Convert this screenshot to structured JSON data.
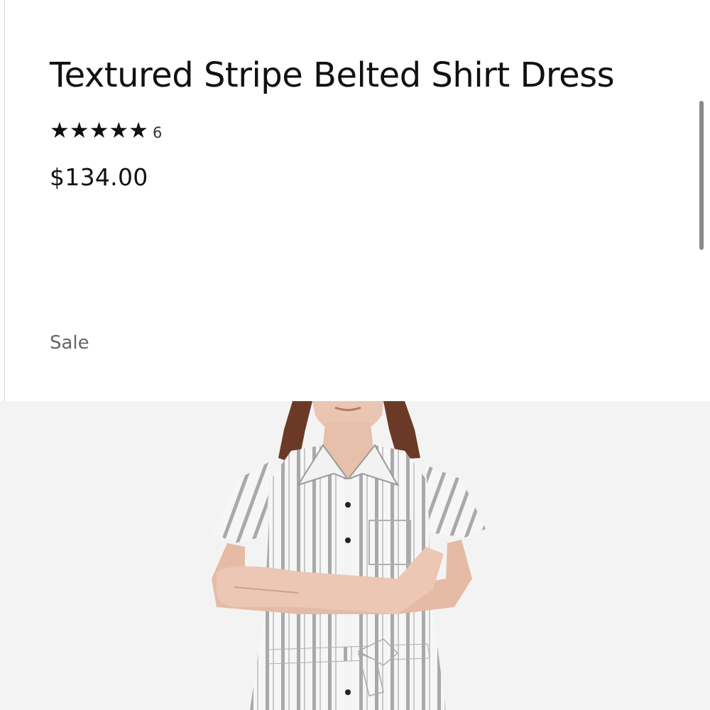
{
  "product": {
    "title": "Textured Stripe Belted Shirt Dress",
    "rating": {
      "stars_text": "★★★★★",
      "value": 5,
      "max": 5,
      "review_count": "6"
    },
    "price": "$134.00",
    "badge": "Sale"
  },
  "image": {
    "icon": "product-photo",
    "description_colors": {
      "background": "#f4f3f3",
      "stripe": "#9a9a9a",
      "fabric": "#f6f6f6",
      "skin": "#e8c3b0",
      "hair": "#6b3a26"
    }
  },
  "scrollbar": {
    "position": 0.12
  }
}
